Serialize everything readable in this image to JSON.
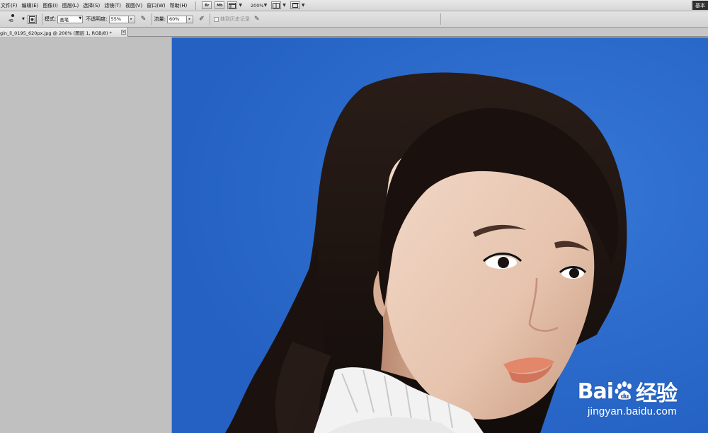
{
  "menubar": {
    "items": [
      "文件(F)",
      "编辑(E)",
      "图像(I)",
      "图层(L)",
      "选择(S)",
      "滤镜(T)",
      "视图(V)",
      "窗口(W)",
      "帮助(H)"
    ],
    "bridge_label": "Br",
    "minibridge_label": "Mb",
    "zoom_level": "200%",
    "workspace_label": "基本"
  },
  "options": {
    "brush_size": "45",
    "mode_label": "模式:",
    "mode_value": "画笔",
    "opacity_label": "不透明度:",
    "opacity_value": "55%",
    "flow_label": "流量:",
    "flow_value": "60%",
    "history_label": "抹到历史记录"
  },
  "document": {
    "tab_title": "gin_li_0195_620px.jpg @ 200% (图层 1, RGB/8) *",
    "close_glyph": "×"
  },
  "watermark": {
    "logo_prefix": "Bai",
    "logo_suffix": "经验",
    "url": "jingyan.baidu.com"
  },
  "colors": {
    "canvas_background": "#2a68c9",
    "pasteboard": "#c0c0c0"
  }
}
